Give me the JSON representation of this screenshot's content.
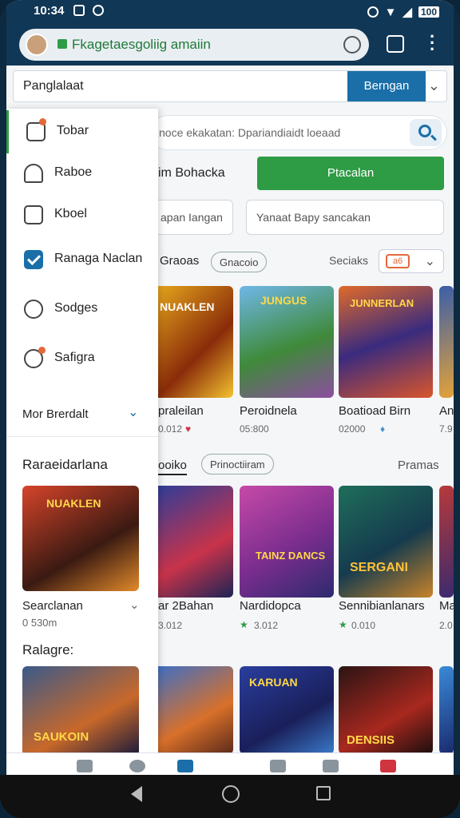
{
  "status": {
    "time": "10:34",
    "battery": "100"
  },
  "browser": {
    "url": "Fkagetaesgoliig amaiin"
  },
  "topbar": {
    "label": "Panglalaat",
    "button": "Berngan"
  },
  "drawer": {
    "items": [
      {
        "label": "Tobar",
        "icon": "phone-icon"
      },
      {
        "label": "Raboe",
        "icon": "hat-icon"
      },
      {
        "label": "Kboel",
        "icon": "folder-icon"
      },
      {
        "label": "Ranaga Naclan",
        "icon": "checkbox-icon"
      },
      {
        "label": "Sodges",
        "icon": "cloud-icon"
      },
      {
        "label": "Safigra",
        "icon": "heart-icon"
      }
    ],
    "more": "Mor  Brerdalt",
    "section1": "Raraeidarlana",
    "card_title": "Searclanan",
    "card_meta": "0 530m",
    "section2": "Ralagre:"
  },
  "main": {
    "search_placeholder": "noce ekakatan: Dpariandiaidt loeaad",
    "row2_text": "im  Bohacka",
    "green_button": "Ptacalan",
    "field1": "apan Iangan",
    "field2": "Yanaat  Bapy sancakan",
    "sec1_title": "Graoas",
    "sec1_chip": "Gnacoio",
    "sort_label": "Seciaks",
    "sort_value": "a6",
    "sec2_chip1": "ooiko",
    "sec2_chip2": "Prinoctiiram",
    "sec2_right": "Pramas",
    "row1": [
      {
        "title": "praleilan",
        "meta": "0.012"
      },
      {
        "title": "Peroidnela",
        "meta": "05:800"
      },
      {
        "title": "Boatioad Birn",
        "meta": "02000"
      },
      {
        "title": "Ant",
        "meta": "7.9"
      }
    ],
    "row2": [
      {
        "title": "ar 2Bahan",
        "meta": "3.012"
      },
      {
        "title": "Nardidopca",
        "meta": "3.012"
      },
      {
        "title": "Sennibianlanars",
        "meta": "0.010"
      },
      {
        "title": "Mar",
        "meta": "2.0"
      }
    ],
    "card_art_texts": [
      "NUAKLEN",
      "JUNGUS",
      "JUNNERLAN",
      "TAINZ DANCS",
      "SERGANI",
      "SAUKOIN",
      "KARUAN",
      "DENSIIS"
    ]
  },
  "colors": {
    "primary": "#1a6fa8",
    "green": "#2e9b45",
    "header": "#103756"
  }
}
